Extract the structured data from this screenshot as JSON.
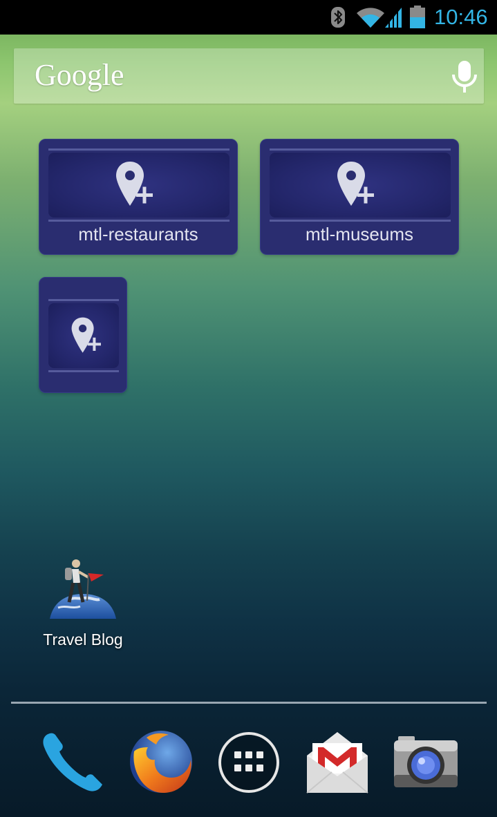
{
  "status_bar": {
    "time": "10:46",
    "icons": [
      "bluetooth-icon",
      "wifi-icon",
      "cell-signal-icon",
      "battery-icon"
    ],
    "accent_color": "#33b5e5"
  },
  "search": {
    "logo_text": "Google",
    "mic_icon": "microphone-icon"
  },
  "widgets": [
    {
      "label": "mtl-restaurants",
      "icon": "map-pin-plus-icon"
    },
    {
      "label": "mtl-museums",
      "icon": "map-pin-plus-icon"
    },
    {
      "label": "",
      "icon": "map-pin-plus-icon"
    }
  ],
  "shortcut": {
    "label": "Travel Blog",
    "icon": "hiker-globe-icon"
  },
  "dock": [
    {
      "name": "Phone",
      "icon": "phone-icon"
    },
    {
      "name": "Firefox",
      "icon": "firefox-icon"
    },
    {
      "name": "All apps",
      "icon": "app-drawer-icon"
    },
    {
      "name": "Gmail",
      "icon": "gmail-icon"
    },
    {
      "name": "Camera",
      "icon": "camera-icon"
    }
  ],
  "colors": {
    "widget_bg": "#2a2d70",
    "widget_border": "#565b9c"
  }
}
